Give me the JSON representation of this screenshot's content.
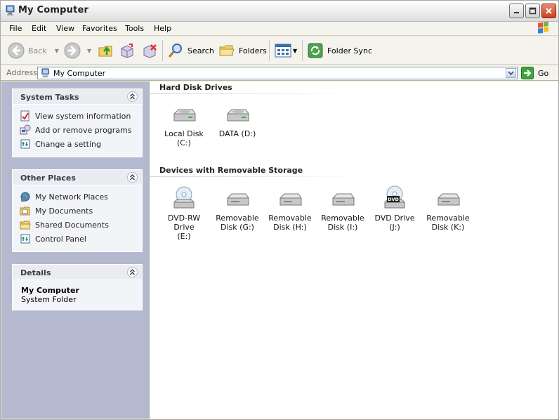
{
  "window": {
    "title": "My Computer"
  },
  "menu": [
    "File",
    "Edit",
    "View",
    "Favorites",
    "Tools",
    "Help"
  ],
  "toolbar": {
    "back": "Back",
    "search": "Search",
    "folders": "Folders",
    "folder_sync": "Folder Sync"
  },
  "address": {
    "label": "Address",
    "value": "My Computer",
    "go": "Go"
  },
  "system_tasks": {
    "title": "System Tasks",
    "items": [
      "View system information",
      "Add or remove programs",
      "Change a setting"
    ]
  },
  "other_places": {
    "title": "Other Places",
    "items": [
      "My Network Places",
      "My Documents",
      "Shared Documents",
      "Control Panel"
    ]
  },
  "details": {
    "title": "Details",
    "name": "My Computer",
    "type": "System Folder"
  },
  "hard_disks": {
    "title": "Hard Disk Drives",
    "drives": [
      {
        "line1": "Local Disk (C:)",
        "line2": ""
      },
      {
        "line1": "DATA (D:)",
        "line2": ""
      }
    ]
  },
  "removable": {
    "title": "Devices with Removable Storage",
    "drives": [
      {
        "line1": "DVD-RW Drive",
        "line2": "(E:)",
        "icon": "dvd-rw-drive-icon"
      },
      {
        "line1": "Removable",
        "line2": "Disk (G:)",
        "icon": "removable-disk-icon"
      },
      {
        "line1": "Removable",
        "line2": "Disk (H:)",
        "icon": "removable-disk-icon"
      },
      {
        "line1": "Removable",
        "line2": "Disk (I:)",
        "icon": "removable-disk-icon"
      },
      {
        "line1": "DVD Drive (J:)",
        "line2": "",
        "icon": "dvd-drive-icon"
      },
      {
        "line1": "Removable",
        "line2": "Disk (K:)",
        "icon": "removable-disk-icon"
      }
    ],
    "dvd_badge": "DVD"
  }
}
